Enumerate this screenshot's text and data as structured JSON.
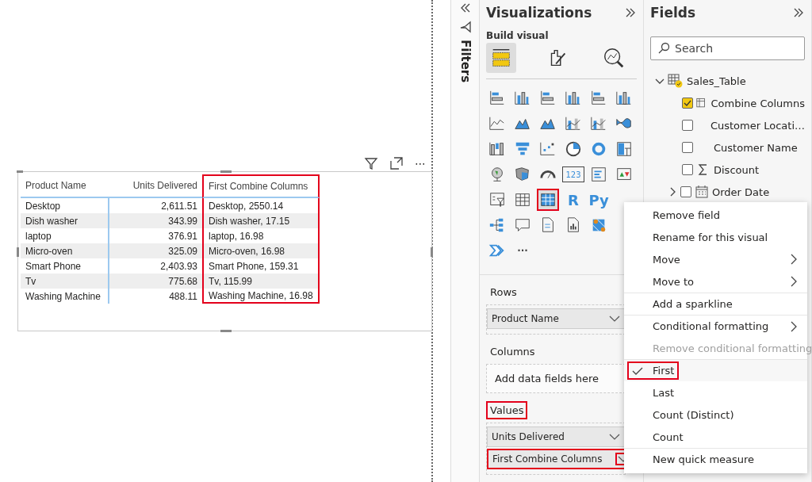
{
  "canvas": {
    "visual_header": {
      "more": "⋯"
    },
    "table": {
      "columns": [
        {
          "label": "Product Name",
          "highlighted": false
        },
        {
          "label": "Units Delivered",
          "highlighted": false
        },
        {
          "label": "First Combine Columns",
          "highlighted": true
        }
      ],
      "rows": [
        [
          "Desktop",
          "2,611.51",
          "Desktop, 2550.14"
        ],
        [
          "Dish washer",
          "343.99",
          "Dish washer, 17.15"
        ],
        [
          "laptop",
          "376.91",
          "laptop, 16.98"
        ],
        [
          "Micro-oven",
          "325.09",
          "Micro-oven, 16.98"
        ],
        [
          "Smart Phone",
          "2,403.93",
          "Smart Phone, 159.31"
        ],
        [
          "Tv",
          "775.68",
          "Tv, 115.99"
        ],
        [
          "Washing Machine",
          "488.11",
          "Washing Machine, 16.98"
        ]
      ]
    }
  },
  "filters_pane": {
    "title": "Filters"
  },
  "visualizations": {
    "title": "Visualizations",
    "subtitle": "Build visual",
    "tabs": [
      {
        "kind": "build",
        "selected": true
      },
      {
        "kind": "format",
        "selected": false
      },
      {
        "kind": "analytics",
        "selected": false
      }
    ],
    "visual_rows": [
      [
        {
          "kind": "hbar",
          "highlighted": false
        },
        {
          "kind": "col",
          "highlighted": false
        },
        {
          "kind": "hbar",
          "highlighted": false
        },
        {
          "kind": "col",
          "highlighted": false
        },
        {
          "kind": "hbar",
          "highlighted": false
        },
        {
          "kind": "col",
          "highlighted": false
        }
      ],
      [
        {
          "kind": "line",
          "highlighted": false
        },
        {
          "kind": "area",
          "highlighted": false
        },
        {
          "kind": "area",
          "highlighted": false
        },
        {
          "kind": "combo",
          "highlighted": false
        },
        {
          "kind": "combo",
          "highlighted": false
        },
        {
          "kind": "ribbon",
          "highlighted": false
        }
      ],
      [
        {
          "kind": "waterfall",
          "highlighted": false
        },
        {
          "kind": "funnel",
          "highlighted": false
        },
        {
          "kind": "scatter",
          "highlighted": false
        },
        {
          "kind": "pie",
          "highlighted": false
        },
        {
          "kind": "donut",
          "highlighted": false
        },
        {
          "kind": "treemap",
          "highlighted": false
        }
      ],
      [
        {
          "kind": "globe",
          "highlighted": false
        },
        {
          "kind": "map",
          "highlighted": false
        },
        {
          "kind": "gauge",
          "highlighted": false
        },
        {
          "kind": "card",
          "label": "123",
          "highlighted": false
        },
        {
          "kind": "multirow",
          "highlighted": false
        },
        {
          "kind": "kpi",
          "highlighted": false
        }
      ],
      [
        {
          "kind": "slicer",
          "highlighted": false
        },
        {
          "kind": "table",
          "highlighted": false
        },
        {
          "kind": "matrix",
          "highlighted": true
        },
        {
          "kind": "letter",
          "label": "R",
          "highlighted": false
        },
        {
          "kind": "letter",
          "label": "Py",
          "highlighted": false
        }
      ],
      [
        {
          "kind": "tree",
          "highlighted": false
        },
        {
          "kind": "speech",
          "highlighted": false
        },
        {
          "kind": "doc",
          "highlighted": false
        },
        {
          "kind": "report",
          "highlighted": false
        },
        {
          "kind": "azuremap",
          "highlighted": false
        }
      ],
      [
        {
          "kind": "automate",
          "highlighted": false
        },
        {
          "kind": "more",
          "label": "···",
          "highlighted": false
        }
      ]
    ],
    "wells": [
      {
        "title": "Rows",
        "highlighted": false,
        "items": [
          {
            "label": "Product Name",
            "highlighted": false
          }
        ]
      },
      {
        "title": "Columns",
        "highlighted": false,
        "placeholder": "Add data fields here"
      },
      {
        "title": "Values",
        "highlighted": true,
        "items": [
          {
            "label": "Units Delivered",
            "highlighted": false
          },
          {
            "label": "First Combine Columns",
            "highlighted": true
          }
        ]
      }
    ]
  },
  "fields": {
    "title": "Fields",
    "search": {
      "placeholder": "Search"
    },
    "tables": [
      {
        "name": "Sales_Table",
        "expanded": true,
        "children": [
          {
            "name": "Combine Columns",
            "kind": "measure",
            "checked": true
          },
          {
            "name": "Customer Locati…",
            "kind": "text",
            "checked": false
          },
          {
            "name": "Customer Name",
            "kind": "text",
            "checked": false
          },
          {
            "name": "Discount",
            "kind": "sum",
            "checked": false
          },
          {
            "name": "Order Date",
            "kind": "date",
            "checked": false,
            "expanded": false
          }
        ]
      }
    ]
  },
  "context_menu": {
    "items": [
      {
        "label": "Remove field",
        "submenu": false,
        "disabled": false,
        "checked": false,
        "divider": false,
        "highlighted": false
      },
      {
        "label": "Rename for this visual",
        "submenu": false,
        "disabled": false,
        "checked": false,
        "divider": false,
        "highlighted": false
      },
      {
        "label": "Move",
        "submenu": true,
        "disabled": false,
        "checked": false,
        "divider": false,
        "highlighted": false
      },
      {
        "label": "Move to",
        "submenu": true,
        "disabled": false,
        "checked": false,
        "divider": false,
        "highlighted": false
      },
      {
        "label": "Add a sparkline",
        "submenu": false,
        "disabled": false,
        "checked": false,
        "divider": true,
        "highlighted": false
      },
      {
        "label": "Conditional formatting",
        "submenu": true,
        "disabled": false,
        "checked": false,
        "divider": true,
        "highlighted": false
      },
      {
        "label": "Remove conditional formatting",
        "submenu": false,
        "disabled": true,
        "checked": false,
        "divider": false,
        "highlighted": false
      },
      {
        "label": "First",
        "submenu": false,
        "disabled": false,
        "checked": true,
        "divider": true,
        "highlighted": true
      },
      {
        "label": "Last",
        "submenu": false,
        "disabled": false,
        "checked": false,
        "divider": false,
        "highlighted": false
      },
      {
        "label": "Count (Distinct)",
        "submenu": false,
        "disabled": false,
        "checked": false,
        "divider": false,
        "highlighted": false
      },
      {
        "label": "Count",
        "submenu": false,
        "disabled": false,
        "checked": false,
        "divider": false,
        "highlighted": false
      },
      {
        "label": "New quick measure",
        "submenu": false,
        "disabled": false,
        "checked": false,
        "divider": true,
        "highlighted": false
      }
    ]
  }
}
